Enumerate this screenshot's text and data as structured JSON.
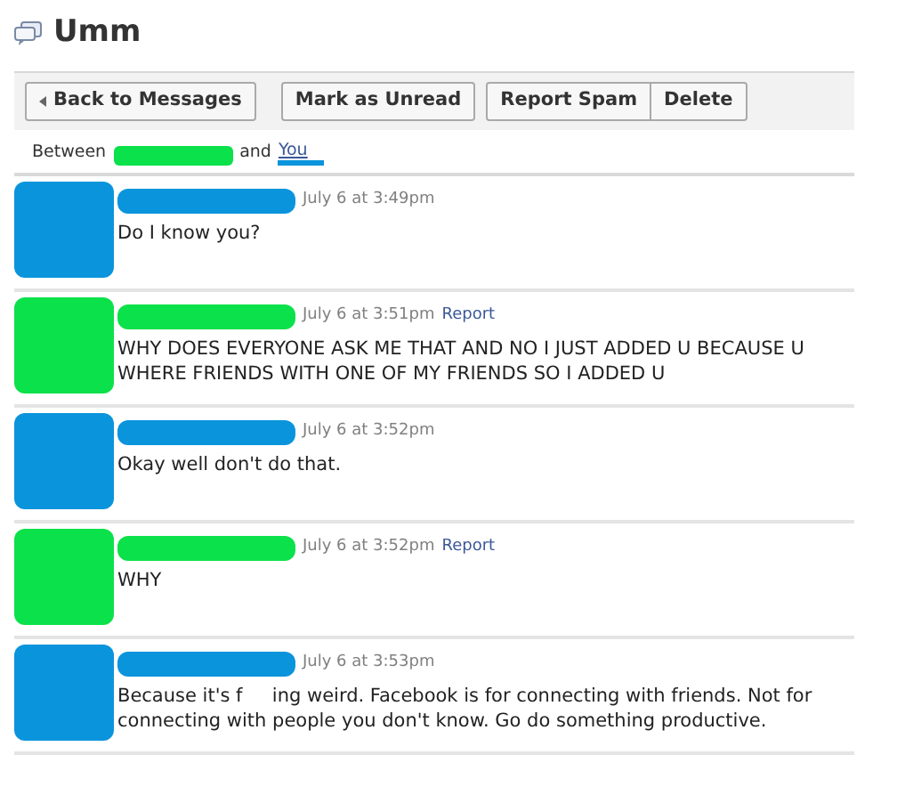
{
  "title": "Umm",
  "toolbar": [
    {
      "label": "Back to Messages",
      "kind": "back"
    },
    {
      "label": "Mark as Unread",
      "kind": "single"
    },
    {
      "label": "Report Spam",
      "kind": "group-start"
    },
    {
      "label": "Delete",
      "kind": "group-end"
    }
  ],
  "participants": [
    {
      "kind": "text",
      "text": "Between"
    },
    {
      "kind": "redaction",
      "color": "#0be14a"
    },
    {
      "kind": "text",
      "text": "and"
    },
    {
      "kind": "link",
      "text": "You",
      "color": "#0a94dc"
    }
  ],
  "messages": [
    {
      "color": "#0a94dc",
      "time": "July 6 at 3:49pm",
      "text": "Do I know you?"
    },
    {
      "color": "#0be14a",
      "time": "July 6 at 3:51pm",
      "report": "Report",
      "text": "WHY DOES EVERYONE ASK ME THAT AND NO I JUST ADDED U BECAUSE U WHERE FRIENDS WITH ONE OF MY FRIENDS SO I ADDED U"
    },
    {
      "color": "#0a94dc",
      "time": "July 6 at 3:52pm",
      "text": "Okay well don't do that."
    },
    {
      "color": "#0be14a",
      "time": "July 6 at 3:52pm",
      "report": "Report",
      "text": "WHY"
    },
    {
      "color": "#0a94dc",
      "time": "July 6 at 3:53pm",
      "text": "Because it's f     ing weird. Facebook is for connecting with friends. Not for connecting with people you don't know. Go do something productive."
    }
  ]
}
